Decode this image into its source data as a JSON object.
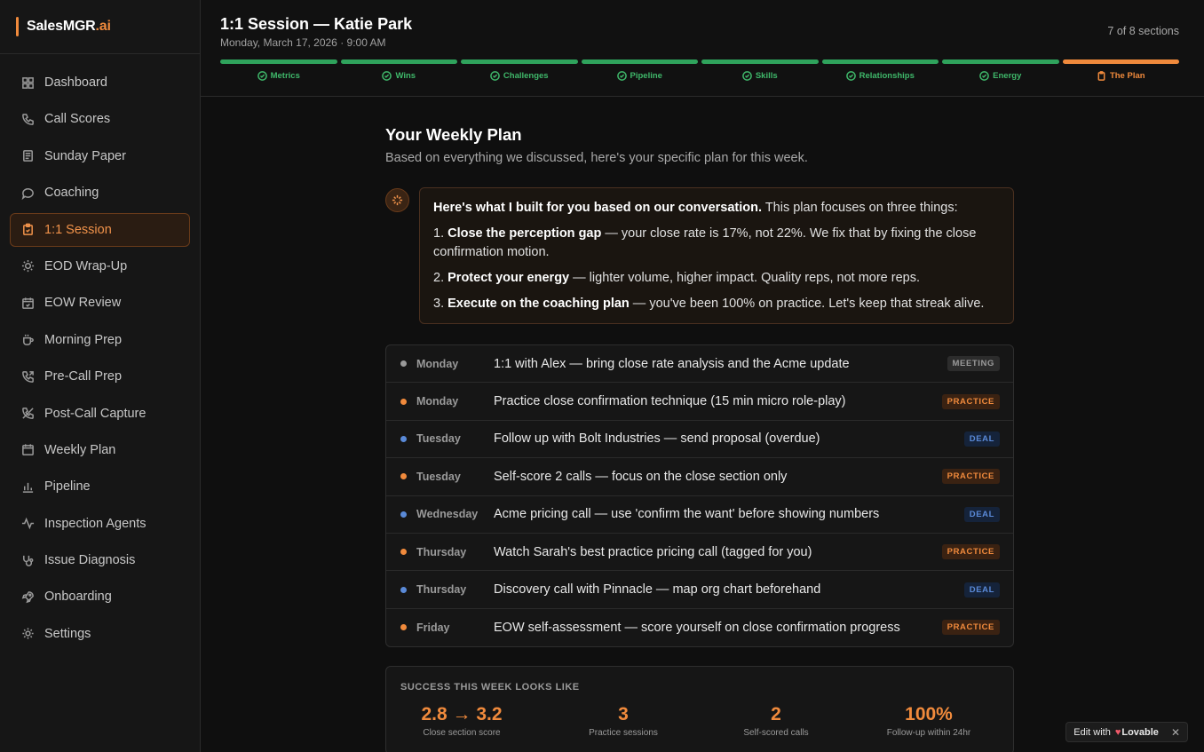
{
  "brand": {
    "name": "SalesMGR",
    "suffix": ".ai"
  },
  "sidebar": {
    "items": [
      {
        "label": "Dashboard",
        "icon": "grid-icon"
      },
      {
        "label": "Call Scores",
        "icon": "phone-icon"
      },
      {
        "label": "Sunday Paper",
        "icon": "newspaper-icon"
      },
      {
        "label": "Coaching",
        "icon": "chat-icon"
      },
      {
        "label": "1:1 Session",
        "icon": "clipboard-icon",
        "active": true
      },
      {
        "label": "EOD Wrap-Up",
        "icon": "sun-icon"
      },
      {
        "label": "EOW Review",
        "icon": "calendar-check-icon"
      },
      {
        "label": "Morning Prep",
        "icon": "coffee-icon"
      },
      {
        "label": "Pre-Call Prep",
        "icon": "phone-outgoing-icon"
      },
      {
        "label": "Post-Call Capture",
        "icon": "phone-off-icon"
      },
      {
        "label": "Weekly Plan",
        "icon": "calendar-icon"
      },
      {
        "label": "Pipeline",
        "icon": "bar-chart-icon"
      },
      {
        "label": "Inspection Agents",
        "icon": "activity-icon"
      },
      {
        "label": "Issue Diagnosis",
        "icon": "stethoscope-icon"
      },
      {
        "label": "Onboarding",
        "icon": "rocket-icon"
      },
      {
        "label": "Settings",
        "icon": "gear-icon"
      }
    ]
  },
  "header": {
    "title": "1:1 Session — Katie Park",
    "subtitle": "Monday, March 17, 2026 · 9:00 AM",
    "progress_text": "7 of 8 sections",
    "steps": [
      {
        "label": "Metrics",
        "state": "done"
      },
      {
        "label": "Wins",
        "state": "done"
      },
      {
        "label": "Challenges",
        "state": "done"
      },
      {
        "label": "Pipeline",
        "state": "done"
      },
      {
        "label": "Skills",
        "state": "done"
      },
      {
        "label": "Relationships",
        "state": "done"
      },
      {
        "label": "Energy",
        "state": "done"
      },
      {
        "label": "The Plan",
        "state": "current"
      }
    ]
  },
  "plan": {
    "title": "Your Weekly Plan",
    "subtitle": "Based on everything we discussed, here's your specific plan for this week.",
    "ai_message": {
      "intro_bold": "Here's what I built for you based on our conversation.",
      "intro_rest": " This plan focuses on three things:",
      "points": [
        {
          "num": "1. ",
          "bold": "Close the perception gap",
          "rest": " — your close rate is 17%, not 22%. We fix that by fixing the close confirmation motion."
        },
        {
          "num": "2. ",
          "bold": "Protect your energy",
          "rest": " — lighter volume, higher impact. Quality reps, not more reps."
        },
        {
          "num": "3. ",
          "bold": "Execute on the coaching plan",
          "rest": " — you've been 100% on practice. Let's keep that streak alive."
        }
      ]
    },
    "tasks": [
      {
        "day": "Monday",
        "text": "1:1 with Alex — bring close rate analysis and the Acme update",
        "tag": "MEETING",
        "type": "meeting"
      },
      {
        "day": "Monday",
        "text": "Practice close confirmation technique (15 min micro role-play)",
        "tag": "PRACTICE",
        "type": "practice"
      },
      {
        "day": "Tuesday",
        "text": "Follow up with Bolt Industries — send proposal (overdue)",
        "tag": "DEAL",
        "type": "deal"
      },
      {
        "day": "Tuesday",
        "text": "Self-score 2 calls — focus on the close section only",
        "tag": "PRACTICE",
        "type": "practice"
      },
      {
        "day": "Wednesday",
        "text": "Acme pricing call — use 'confirm the want' before showing numbers",
        "tag": "DEAL",
        "type": "deal"
      },
      {
        "day": "Thursday",
        "text": "Watch Sarah's best practice pricing call (tagged for you)",
        "tag": "PRACTICE",
        "type": "practice"
      },
      {
        "day": "Thursday",
        "text": "Discovery call with Pinnacle — map org chart beforehand",
        "tag": "DEAL",
        "type": "deal"
      },
      {
        "day": "Friday",
        "text": "EOW self-assessment — score yourself on close confirmation progress",
        "tag": "PRACTICE",
        "type": "practice"
      }
    ],
    "dot_colors": {
      "meeting": "#9a9a9a",
      "practice": "#f08a3c",
      "deal": "#5a8ad8"
    },
    "success": {
      "heading": "SUCCESS THIS WEEK LOOKS LIKE",
      "metrics": [
        {
          "value": "2.8 → 3.2",
          "label": "Close section score"
        },
        {
          "value": "3",
          "label": "Practice sessions"
        },
        {
          "value": "2",
          "label": "Self-scored calls"
        },
        {
          "value": "100%",
          "label": "Follow-up within 24hr"
        }
      ]
    }
  },
  "badge": {
    "prefix": "Edit with",
    "name": "Lovable",
    "close": "✕"
  }
}
